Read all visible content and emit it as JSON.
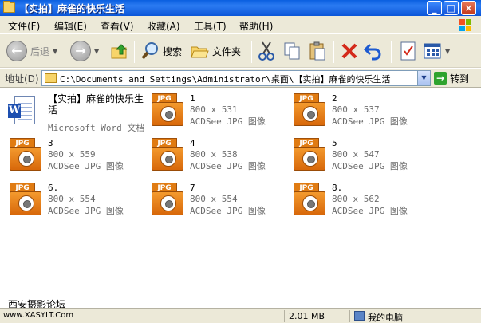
{
  "window": {
    "title": "【实拍】麻雀的快乐生活",
    "controls": [
      "_",
      "□",
      "×"
    ]
  },
  "menu": [
    "文件(F)",
    "编辑(E)",
    "查看(V)",
    "收藏(A)",
    "工具(T)",
    "帮助(H)"
  ],
  "toolbar": {
    "back_label": "后退",
    "search_label": "搜索",
    "folders_label": "文件夹"
  },
  "address": {
    "label": "地址(D)",
    "path": "C:\\Documents and Settings\\Administrator\\桌面\\【实拍】麻雀的快乐生活",
    "go_label": "转到"
  },
  "files": [
    {
      "name": "【实拍】麻雀的快乐生活",
      "dims": "",
      "type": "Microsoft Word 文档",
      "icon": "word-doc-icon"
    },
    {
      "name": "1",
      "dims": "800 x 531",
      "type": "ACDSee JPG 图像",
      "icon": "jpg-icon"
    },
    {
      "name": "2",
      "dims": "800 x 537",
      "type": "ACDSee JPG 图像",
      "icon": "jpg-icon"
    },
    {
      "name": "3",
      "dims": "800 x 559",
      "type": "ACDSee JPG 图像",
      "icon": "jpg-icon"
    },
    {
      "name": "4",
      "dims": "800 x 538",
      "type": "ACDSee JPG 图像",
      "icon": "jpg-icon"
    },
    {
      "name": "5",
      "dims": "800 x 547",
      "type": "ACDSee JPG 图像",
      "icon": "jpg-icon"
    },
    {
      "name": "6.",
      "dims": "800 x 554",
      "type": "ACDSee JPG 图像",
      "icon": "jpg-icon"
    },
    {
      "name": "7",
      "dims": "800 x 554",
      "type": "ACDSee JPG 图像",
      "icon": "jpg-icon"
    },
    {
      "name": "8.",
      "dims": "800 x 562",
      "type": "ACDSee JPG 图像",
      "icon": "jpg-icon"
    }
  ],
  "icon_tag": "JPG",
  "status": {
    "size": "2.01 MB",
    "location": "我的电脑"
  },
  "watermark": {
    "line1": "西安摄影论坛",
    "line2": "www.XASYLT.Com"
  }
}
